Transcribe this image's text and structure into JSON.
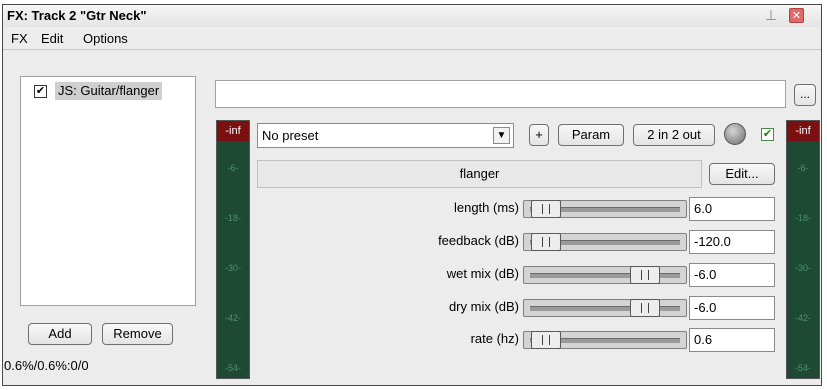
{
  "window": {
    "title": "FX: Track 2 \"Gtr Neck\"",
    "pin_icon": "pin-icon",
    "close_icon": "close-icon"
  },
  "menu": {
    "items": [
      "FX",
      "Edit",
      "Options"
    ]
  },
  "fx_chain": {
    "items": [
      {
        "label": "JS: Guitar/flanger",
        "checked": true
      }
    ],
    "add_label": "Add",
    "remove_label": "Remove",
    "status": "0.6%/0.6%:0/0"
  },
  "browse_label": "...",
  "preset": {
    "value": "No preset",
    "plus_label": "+",
    "param_label": "Param",
    "io_label": "2 in 2 out"
  },
  "meters": {
    "peak": "-inf",
    "ticks": [
      "-6-",
      "-18-",
      "-30-",
      "-42-",
      "-54-"
    ]
  },
  "plugin": {
    "name": "flanger",
    "edit_label": "Edit...",
    "params": [
      {
        "label": "length (ms)",
        "value": "6.0",
        "position": 0.05
      },
      {
        "label": "feedback (dB)",
        "value": "-120.0",
        "position": 0.05
      },
      {
        "label": "wet mix (dB)",
        "value": "-6.0",
        "position": 0.8
      },
      {
        "label": "dry mix (dB)",
        "value": "-6.0",
        "position": 0.8
      },
      {
        "label": "rate (hz)",
        "value": "0.6",
        "position": 0.05
      }
    ]
  }
}
